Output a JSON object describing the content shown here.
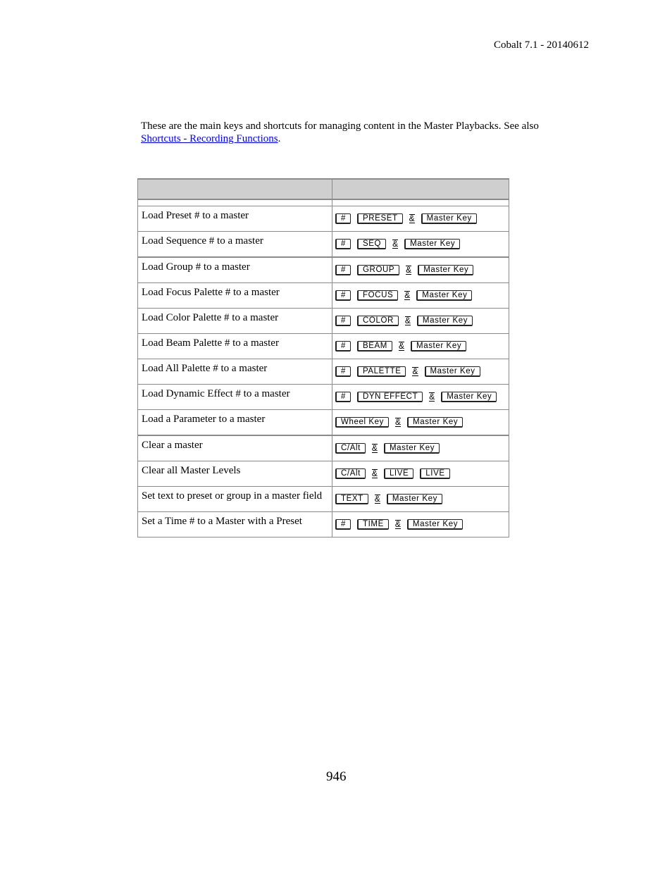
{
  "header": {
    "doc_version": "Cobalt 7.1 - 20140612"
  },
  "intro": {
    "text": "These are the main keys and shortcuts for managing content in the Master Playbacks. See also ",
    "link_text": "Shortcuts - Recording Functions",
    "trailing": "."
  },
  "table": {
    "headers": [
      "",
      ""
    ],
    "rows": [
      {
        "action": "Load Preset # to a master",
        "keys": [
          "#",
          "PRESET",
          "&",
          "Master Key"
        ]
      },
      {
        "action": "Load Sequence # to a master",
        "keys": [
          "#",
          "SEQ",
          "&",
          "Master Key"
        ]
      },
      {
        "action": "Load Group # to a master",
        "keys": [
          "#",
          "GROUP",
          "&",
          "Master Key"
        ]
      },
      {
        "action": "Load Focus Palette # to a master",
        "keys": [
          "#",
          "FOCUS",
          "&",
          "Master Key"
        ]
      },
      {
        "action": "Load Color Palette # to a master",
        "keys": [
          "#",
          "COLOR",
          "&",
          "Master Key"
        ]
      },
      {
        "action": "Load Beam Palette # to a master",
        "keys": [
          "#",
          "BEAM",
          "&",
          "Master Key"
        ]
      },
      {
        "action": "Load All Palette # to a master",
        "keys": [
          "#",
          "PALETTE",
          "&",
          "Master Key"
        ]
      },
      {
        "action": "Load Dynamic Effect # to a master",
        "keys": [
          "#",
          "DYN EFFECT",
          "&",
          "Master Key"
        ]
      },
      {
        "action": "Load a Parameter to a master",
        "keys": [
          "Wheel Key",
          "&",
          "Master Key"
        ]
      },
      {
        "action": "Clear a master",
        "keys": [
          "C/Alt",
          "&",
          "Master Key"
        ]
      },
      {
        "action": "Clear all Master Levels",
        "keys": [
          "C/Alt",
          "&",
          "LIVE",
          "LIVE"
        ]
      },
      {
        "action": "Set text to preset or group in a master field",
        "keys": [
          "TEXT",
          "&",
          "Master Key"
        ]
      },
      {
        "action": "Set a Time # to a Master with a Preset",
        "keys": [
          "#",
          "TIME",
          "&",
          "Master Key"
        ]
      }
    ]
  },
  "footer": {
    "page_number": "946"
  }
}
